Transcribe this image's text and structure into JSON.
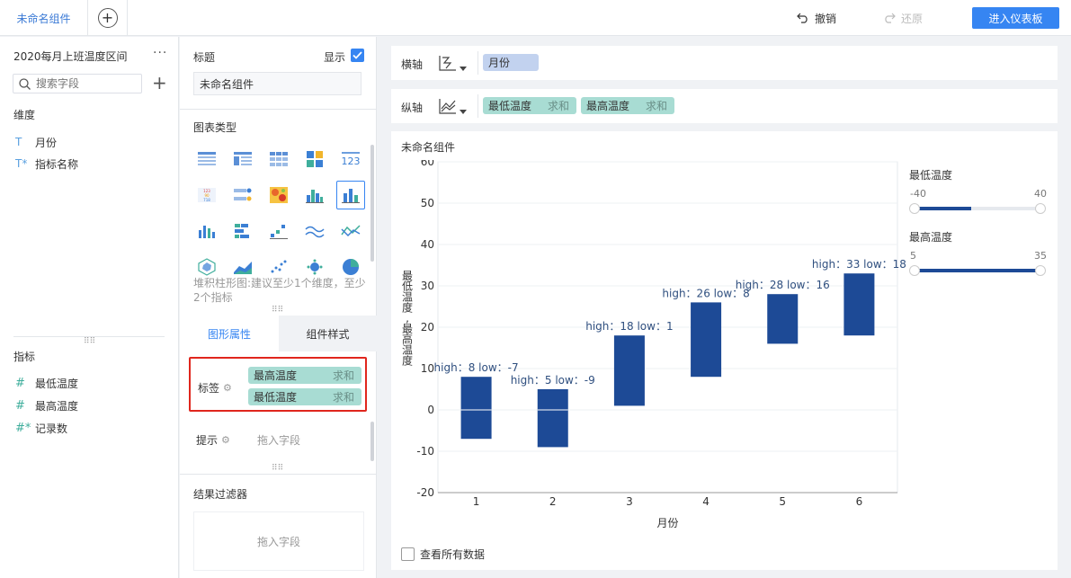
{
  "topbar": {
    "active_tab": "未命名组件",
    "undo_label": "撤销",
    "redo_label": "还原",
    "enter_dashboard_label": "进入仪表板"
  },
  "left_panel": {
    "dataset_name": "2020每月上班温度区间",
    "search_placeholder": "搜索字段",
    "dimension_title": "维度",
    "dimensions": [
      {
        "icon": "T",
        "label": "月份"
      },
      {
        "icon": "T*",
        "label": "指标名称"
      }
    ],
    "measure_title": "指标",
    "measures": [
      {
        "icon": "#",
        "label": "最低温度"
      },
      {
        "icon": "#",
        "label": "最高温度"
      },
      {
        "icon": "#*",
        "label": "记录数"
      }
    ]
  },
  "config_panel": {
    "title_label": "标题",
    "show_label": "显示",
    "title_value": "未命名组件",
    "chart_type_label": "图表类型",
    "chart_type_hint": "堆积柱形图:建议至少1个维度，至少2个指标",
    "tabs": [
      "图形属性",
      "组件样式"
    ],
    "label_section": {
      "title": "标签",
      "pills": [
        {
          "field": "最高温度",
          "agg": "求和"
        },
        {
          "field": "最低温度",
          "agg": "求和"
        }
      ]
    },
    "tooltip_section": {
      "title": "提示",
      "placeholder": "拖入字段"
    },
    "filter_label": "结果过滤器",
    "filter_placeholder": "拖入字段"
  },
  "axes": {
    "x_label": "横轴",
    "x_pill": "月份",
    "y_label": "纵轴",
    "y_pills": [
      {
        "field": "最低温度",
        "agg": "求和"
      },
      {
        "field": "最高温度",
        "agg": "求和"
      }
    ]
  },
  "chart_card": {
    "title": "未命名组件",
    "view_all_label": "查看所有数据"
  },
  "legend": {
    "items": [
      {
        "title": "最低温度",
        "min": "-40",
        "max": "40",
        "fill": [
          0.0,
          0.45
        ]
      },
      {
        "title": "最高温度",
        "min": "5",
        "max": "35",
        "fill": [
          0.0,
          1.0
        ]
      }
    ]
  },
  "chart_data": {
    "type": "bar",
    "subtype": "floating-range",
    "categories": [
      "1",
      "2",
      "3",
      "4",
      "5",
      "6"
    ],
    "high": [
      8,
      5,
      18,
      26,
      28,
      33
    ],
    "low": [
      -7,
      -9,
      1,
      8,
      16,
      18
    ],
    "data_labels": [
      "high：8 low：-7",
      "high：5 low：-9",
      "high：18 low：1",
      "high：26 low：8",
      "high：28 low：16",
      "high：33 low：18"
    ],
    "xlabel": "月份",
    "ylabel": "最低温度,最高温度",
    "ylim": [
      -20,
      60
    ],
    "yticks": [
      -20,
      -10,
      0,
      10,
      20,
      30,
      40,
      50,
      60
    ],
    "bar_color": "#1d4a96",
    "label_color": "#2f4f7f"
  },
  "colors": {
    "accent": "#3685f2",
    "dimension_pill": "#c2d2ef",
    "measure_pill": "#a8dcd3",
    "highlight_border": "#e0261d"
  }
}
